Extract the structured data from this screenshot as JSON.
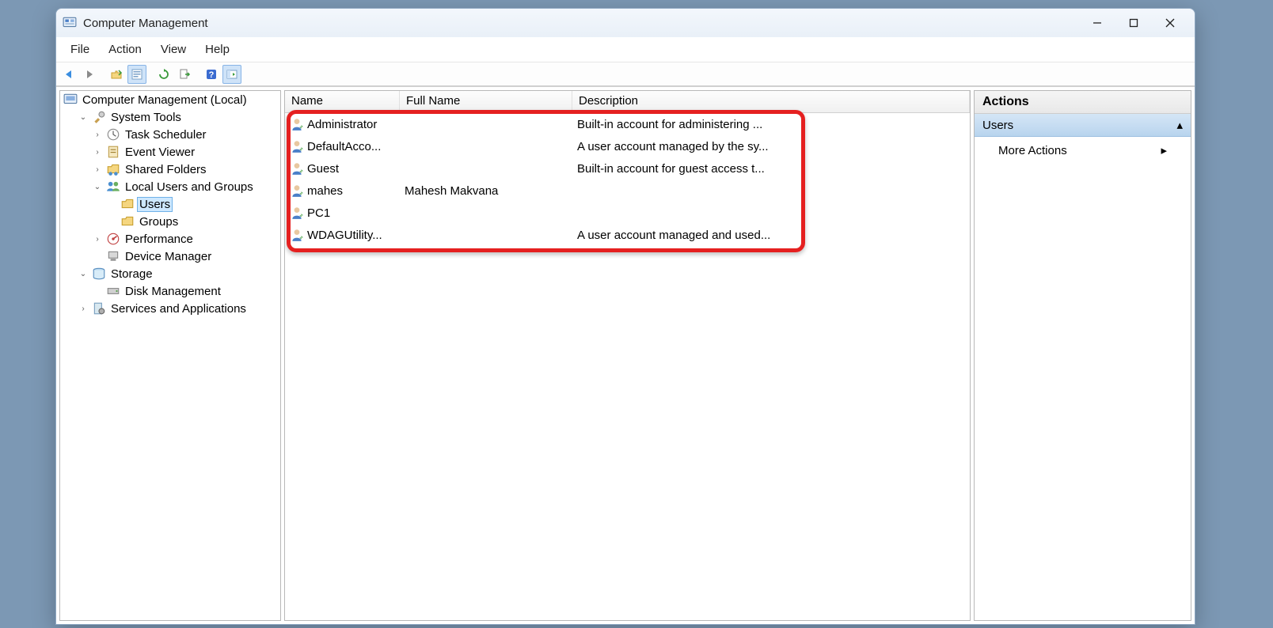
{
  "window": {
    "title": "Computer Management"
  },
  "menubar": {
    "file": "File",
    "action": "Action",
    "view": "View",
    "help": "Help"
  },
  "tree": {
    "root": "Computer Management (Local)",
    "system_tools": "System Tools",
    "task_scheduler": "Task Scheduler",
    "event_viewer": "Event Viewer",
    "shared_folders": "Shared Folders",
    "local_users_groups": "Local Users and Groups",
    "users": "Users",
    "groups": "Groups",
    "performance": "Performance",
    "device_manager": "Device Manager",
    "storage": "Storage",
    "disk_management": "Disk Management",
    "services_apps": "Services and Applications"
  },
  "list": {
    "headers": {
      "name": "Name",
      "full_name": "Full Name",
      "description": "Description"
    },
    "rows": [
      {
        "name": "Administrator",
        "full": "",
        "desc": "Built-in account for administering ..."
      },
      {
        "name": "DefaultAcco...",
        "full": "",
        "desc": "A user account managed by the sy..."
      },
      {
        "name": "Guest",
        "full": "",
        "desc": "Built-in account for guest access t..."
      },
      {
        "name": "mahes",
        "full": "Mahesh Makvana",
        "desc": ""
      },
      {
        "name": "PC1",
        "full": "",
        "desc": ""
      },
      {
        "name": "WDAGUtility...",
        "full": "",
        "desc": "A user account managed and used..."
      }
    ]
  },
  "actions": {
    "header": "Actions",
    "section": "Users",
    "more": "More Actions"
  }
}
